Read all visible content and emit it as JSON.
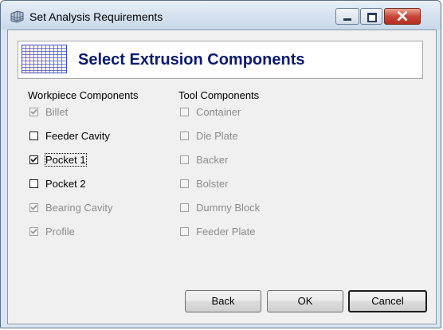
{
  "window": {
    "title": "Set Analysis Requirements"
  },
  "banner": {
    "title": "Select Extrusion Components"
  },
  "workpiece": {
    "heading": "Workpiece Components",
    "items": [
      {
        "label": "Billet",
        "checked": true,
        "enabled": false
      },
      {
        "label": "Feeder Cavity",
        "checked": false,
        "enabled": true
      },
      {
        "label": "Pocket 1",
        "checked": true,
        "enabled": true,
        "focused": true
      },
      {
        "label": "Pocket 2",
        "checked": false,
        "enabled": true
      },
      {
        "label": "Bearing Cavity",
        "checked": true,
        "enabled": false
      },
      {
        "label": "Profile",
        "checked": true,
        "enabled": false
      }
    ]
  },
  "tool": {
    "heading": "Tool Components",
    "items": [
      {
        "label": "Container",
        "checked": false,
        "enabled": false
      },
      {
        "label": "Die Plate",
        "checked": false,
        "enabled": false
      },
      {
        "label": "Backer",
        "checked": false,
        "enabled": false
      },
      {
        "label": "Bolster",
        "checked": false,
        "enabled": false
      },
      {
        "label": "Dummy Block",
        "checked": false,
        "enabled": false
      },
      {
        "label": "Feeder Plate",
        "checked": false,
        "enabled": false
      }
    ]
  },
  "buttons": {
    "back": "Back",
    "ok": "OK",
    "cancel": "Cancel"
  },
  "colors": {
    "banner_title": "#0a1a6e",
    "disabled_text": "#8d8d8d",
    "close_button": "#c9473a"
  }
}
